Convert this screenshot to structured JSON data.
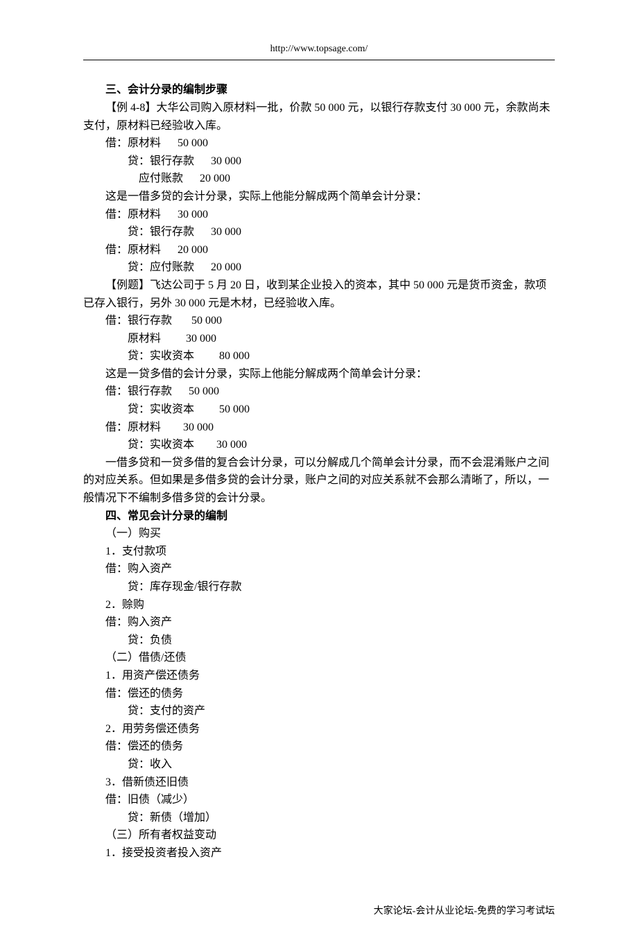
{
  "header": {
    "url": "http://www.topsage.com/"
  },
  "section3": {
    "title": "三、会计分录的编制步骤",
    "example48": "【例 4-8】大华公司购入原材料一批，价款 50 000 元，以银行存款支付 30 000 元，余款尚未支付，原材料已经验收入库。",
    "entry1": "借：原材料      50 000",
    "entry2": "贷：银行存款      30 000",
    "entry3": "应付账款      20 000",
    "note1": "这是一借多贷的会计分录，实际上他能分解成两个简单会计分录：",
    "entry4": "借：原材料      30 000",
    "entry5": "贷：银行存款      30 000",
    "entry6": "借：原材料      20 000",
    "entry7": "贷：应付账款      20 000",
    "example2": "【例题】飞达公司于 5 月 20 日，收到某企业投入的资本，其中 50 000 元是货币资金，款项已存入银行，另外 30 000 元是木材，已经验收入库。",
    "entry8": "借：银行存款       50 000",
    "entry9": "原材料         30 000",
    "entry10": "贷：实收资本         80 000",
    "note2": "这是一贷多借的会计分录，实际上他能分解成两个简单会计分录：",
    "entry11": "借：银行存款      50 000",
    "entry12": "贷：实收资本         50 000",
    "entry13": "借：原材料        30 000",
    "entry14": "贷：实收资本        30 000",
    "summary": "一借多贷和一贷多借的复合会计分录，可以分解成几个简单会计分录，而不会混淆账户之间的对应关系。但如果是多借多贷的会计分录，账户之间的对应关系就不会那么清晰了，所以，一般情况下不编制多借多贷的会计分录。"
  },
  "section4": {
    "title": "四、常见会计分录的编制",
    "sub1": "（一）购买",
    "item1_1": "1．支付款项",
    "item1_1_d": "借：购入资产",
    "item1_1_c": "贷：库存现金/银行存款",
    "item1_2": "2．赊购",
    "item1_2_d": "借：购入资产",
    "item1_2_c": "贷：负债",
    "sub2": "（二）借债/还债",
    "item2_1": "1．用资产偿还债务",
    "item2_1_d": "借：偿还的债务",
    "item2_1_c": "贷：支付的资产",
    "item2_2": "2．用劳务偿还债务",
    "item2_2_d": "借：偿还的债务",
    "item2_2_c": "贷：收入",
    "item2_3": "3．借新债还旧债",
    "item2_3_d": "借：旧债（减少）",
    "item2_3_c": "贷：新债（增加）",
    "sub3": "（三）所有者权益变动",
    "item3_1": "1．接受投资者投入资产"
  },
  "footer": {
    "text": "大家论坛-会计从业论坛-免费的学习考试坛"
  }
}
